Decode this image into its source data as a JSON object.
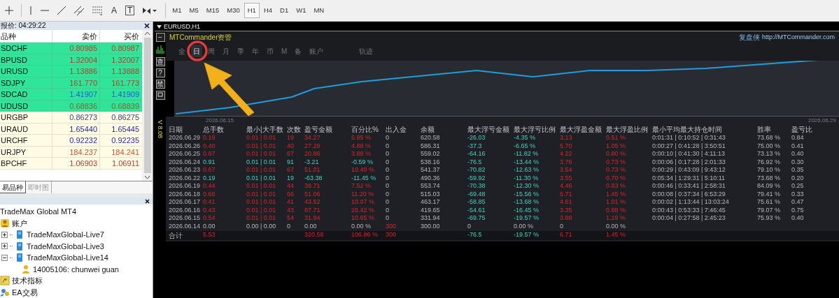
{
  "toolbar": {
    "text_tools": [
      "A",
      "T"
    ],
    "timeframes": [
      {
        "label": "M1",
        "selected": false
      },
      {
        "label": "M5",
        "selected": false
      },
      {
        "label": "M15",
        "selected": false
      },
      {
        "label": "M30",
        "selected": false
      },
      {
        "label": "H1",
        "selected": true
      },
      {
        "label": "H4",
        "selected": false
      },
      {
        "label": "D1",
        "selected": false
      },
      {
        "label": "W1",
        "selected": false
      },
      {
        "label": "MN",
        "selected": false
      }
    ]
  },
  "market_watch": {
    "title": "报价: 04:29:22",
    "columns": [
      "品种",
      "卖价",
      "买价"
    ],
    "rows": [
      {
        "symbol": "SDCHF",
        "bid": "0.80985",
        "ask": "0.80987",
        "highlighted": true,
        "color": "#c0392b"
      },
      {
        "symbol": "BPUSD",
        "bid": "1.32004",
        "ask": "1.32007",
        "highlighted": true,
        "color": "#c0392b"
      },
      {
        "symbol": "URUSD",
        "bid": "1.13886",
        "ask": "1.13888",
        "highlighted": true,
        "color": "#c0392b"
      },
      {
        "symbol": "SDJPY",
        "bid": "161.770",
        "ask": "161.773",
        "highlighted": true,
        "color": "#c0392b"
      },
      {
        "symbol": "SDCAD",
        "bid": "1.41907",
        "ask": "1.41909",
        "highlighted": true,
        "color": "#1f5fd6"
      },
      {
        "symbol": "UDUSD",
        "bid": "0.68836",
        "ask": "0.68839",
        "highlighted": true,
        "color": "#7a6a2a"
      },
      {
        "symbol": "URGBP",
        "bid": "0.86273",
        "ask": "0.86275",
        "highlighted": false,
        "color": "#3a3a9a"
      },
      {
        "symbol": "URAUD",
        "bid": "1.65440",
        "ask": "1.65445",
        "highlighted": false,
        "color": "#2a2a9a"
      },
      {
        "symbol": "URCHF",
        "bid": "0.92232",
        "ask": "0.92235",
        "highlighted": false,
        "color": "#2a2a9a"
      },
      {
        "symbol": "URJPY",
        "bid": "184.237",
        "ask": "184.241",
        "highlighted": false,
        "color": "#d2562b"
      },
      {
        "symbol": "BPCHF",
        "bid": "1.06903",
        "ask": "1.06911",
        "highlighted": false,
        "color": "#d63030"
      }
    ],
    "tabs": [
      {
        "label": "易品种",
        "selected": true
      },
      {
        "label": "即时图",
        "selected": false
      }
    ]
  },
  "navigator": {
    "tree": [
      {
        "label": "TradeMax Global MT4",
        "children": [
          {
            "label": "账户",
            "kind": "accounts",
            "children": [
              {
                "label": "TradeMaxGlobal-Live7",
                "kind": "server",
                "expanded": false
              },
              {
                "label": "TradeMaxGlobal-Live3",
                "kind": "server",
                "expanded": false
              },
              {
                "label": "TradeMaxGlobal-Live14",
                "kind": "server",
                "expanded": true,
                "children": [
                  {
                    "label": "14005106: chunwei guan",
                    "kind": "user"
                  }
                ]
              }
            ]
          },
          {
            "label": "技术指标",
            "kind": "indicators"
          },
          {
            "label": "EA交易",
            "kind": "experts"
          }
        ]
      }
    ]
  },
  "chart_window": {
    "title": "EURUSD,H1",
    "side_buttons": [
      {
        "kind": "glyph",
        "label": "−"
      },
      {
        "kind": "bars"
      },
      {
        "kind": "glyph",
        "label": "查"
      },
      {
        "kind": "glyph",
        "label": "?"
      },
      {
        "kind": "glyph",
        "label": "禁"
      },
      {
        "kind": "window"
      }
    ],
    "version": "V 8.08",
    "panel": {
      "title": "MTCommander资管",
      "brand": "复盘侠",
      "link": "http://MTCommander.com",
      "tabs": [
        {
          "label": "全",
          "selected": false
        },
        {
          "label": "日",
          "selected": true
        },
        {
          "label": "周",
          "selected": false
        },
        {
          "label": "月",
          "selected": false
        },
        {
          "label": "季",
          "selected": false
        },
        {
          "label": "年",
          "selected": false
        },
        {
          "label": "币",
          "selected": false
        },
        {
          "label": "M",
          "selected": false
        },
        {
          "label": "备",
          "selected": false
        },
        {
          "label": "账户",
          "selected": false
        },
        {
          "label": "轨迹",
          "selected": false
        }
      ],
      "x_labels": [
        "2026.06.15",
        "2026.06.29"
      ],
      "table": {
        "columns": [
          {
            "label": "日期",
            "kind": "plain"
          },
          {
            "label": "总手数",
            "kind": "trade"
          },
          {
            "label": "最小|大手数",
            "kind": "trade"
          },
          {
            "label": "次数",
            "kind": "trade"
          },
          {
            "label": "盈亏金额",
            "kind": "trade"
          },
          {
            "label": "百分比%",
            "kind": "trade"
          },
          {
            "label": "出入金",
            "kind": "deposit"
          },
          {
            "label": "余额",
            "kind": "plain"
          },
          {
            "label": "最大浮亏金额",
            "kind": "drawdown"
          },
          {
            "label": "最大浮亏比例",
            "kind": "drawdown"
          },
          {
            "label": "最大浮盈金额",
            "kind": "runup"
          },
          {
            "label": "最大浮盈比例",
            "kind": "runup"
          },
          {
            "label": "最小平均最大持仓时间",
            "kind": "plain"
          },
          {
            "label": "胜率",
            "kind": "plain"
          },
          {
            "label": "盈亏比",
            "kind": "plain"
          }
        ],
        "rows": [
          {
            "kind": "gain",
            "cells": [
              "2026.06.29",
              "0.19",
              "0.01 | 0.01",
              "19",
              "34.27",
              "5.85 %",
              "0",
              "620.58",
              "-26.03",
              "-4.35 %",
              "3.13",
              "0.51 %",
              "0:01:31 | 0:10:52 | 0:31:43",
              "73.68 %",
              "0.84"
            ]
          },
          {
            "kind": "gain",
            "cells": [
              "2026.06.26",
              "0.40",
              "0.01 | 0.01",
              "40",
              "27.29",
              "4.88 %",
              "0",
              "586.31",
              "-37.3",
              "-6.65 %",
              "5.70",
              "1.05 %",
              "0:00:27 | 0:41:28 | 3:50:51",
              "75.00 %",
              "0.41"
            ]
          },
          {
            "kind": "gain",
            "cells": [
              "2026.06.25",
              "0.67",
              "0.01 | 0.01",
              "67",
              "20.86",
              "3.88 %",
              "0",
              "559.02",
              "-64.16",
              "-11.82 %",
              "4.22",
              "0.80 %",
              "0:00:10 | 0:41:30 | 4:11:13",
              "73.13 %",
              "0.40"
            ]
          },
          {
            "kind": "loss",
            "cells": [
              "2026.06.24",
              "0.91",
              "0.01 | 0.01",
              "91",
              "-3.21",
              "-0.59 %",
              "0",
              "538.16",
              "-76.5",
              "-13.44 %",
              "3.76",
              "0.73 %",
              "0:00:06 | 0:17:28 | 2:01:33",
              "76.92 %",
              "0.30"
            ]
          },
          {
            "kind": "gain",
            "cells": [
              "2026.06.23",
              "0.67",
              "0.01 | 0.01",
              "67",
              "51.01",
              "10.40 %",
              "0",
              "541.37",
              "-70.82",
              "-12.63 %",
              "3.54",
              "0.73 %",
              "0:00:29 | 0:43:09 | 9:43:12",
              "79.10 %",
              "0.35"
            ]
          },
          {
            "kind": "loss",
            "cells": [
              "2026.06.22",
              "0.19",
              "0.01 | 0.01",
              "19",
              "-63.38",
              "-11.45 %",
              "0",
              "490.36",
              "-59.92",
              "-11.30 %",
              "3.55",
              "0.70 %",
              "0:05:34 | 1:29:31 | 5:10:11",
              "73.68 %",
              "0.20"
            ]
          },
          {
            "kind": "gain",
            "cells": [
              "2026.06.19",
              "0.44",
              "0.01 | 0.01",
              "44",
              "38.71",
              "7.52 %",
              "0",
              "553.74",
              "-70.38",
              "-12.30 %",
              "4.46",
              "0.83 %",
              "0:00:46 | 0:33:41 | 2:58:31",
              "84.09 %",
              "0.25"
            ]
          },
          {
            "kind": "gain",
            "cells": [
              "2026.06.18",
              "0.66",
              "0.01 | 0.01",
              "66",
              "51.06",
              "11.20 %",
              "0",
              "515.03",
              "-69.48",
              "-15.56 %",
              "6.71",
              "1.45 %",
              "0:00:08 | 0:37:34 | 6:53:29",
              "79.41 %",
              "0.33"
            ]
          },
          {
            "kind": "gain",
            "cells": [
              "2026.06.17",
              "0.41",
              "0.01 | 0.01",
              "41",
              "43.52",
              "10.07 %",
              "0",
              "463.17",
              "-58.85",
              "-13.68 %",
              "4.61",
              "1.01 %",
              "0:00:02 | 1:13:44 | 13:03:24",
              "75.61 %",
              "0.47"
            ]
          },
          {
            "kind": "gain",
            "cells": [
              "2026.06.16",
              "0.43",
              "0.01 | 0.01",
              "43",
              "87.71",
              "26.42 %",
              "0",
              "419.65",
              "-54.61",
              "-16.45 %",
              "3.35",
              "0.88 %",
              "0:00:43 | 0:53:33 | 7:46:45",
              "79.07 %",
              "0.75"
            ]
          },
          {
            "kind": "gain",
            "cells": [
              "2026.06.15",
              "0.54",
              "0.01 | 0.01",
              "54",
              "31.94",
              "10.65 %",
              "0",
              "331.94",
              "-69.75",
              "-19.57 %",
              "3.88",
              "1.19 %",
              "0:00:04 | 0:27:58 | 2:45:23",
              "75.93 %",
              "0.40"
            ]
          },
          {
            "kind": "flat",
            "cells": [
              "2026.06.14",
              "0.00",
              "0.00 | 0.00",
              "0",
              "0.00",
              "0.00 %",
              "300",
              "300.00",
              "0",
              "0.00 %",
              "0",
              "0.00 %",
              "",
              "",
              ""
            ]
          },
          {
            "kind": "total",
            "cells": [
              "合计",
              "5.53",
              "",
              "",
              "320.58",
              "106.86 %",
              "300",
              "",
              "-76.5",
              "-19.57 %",
              "6.71",
              "1.45 %",
              "",
              "",
              ""
            ]
          }
        ]
      }
    }
  }
}
